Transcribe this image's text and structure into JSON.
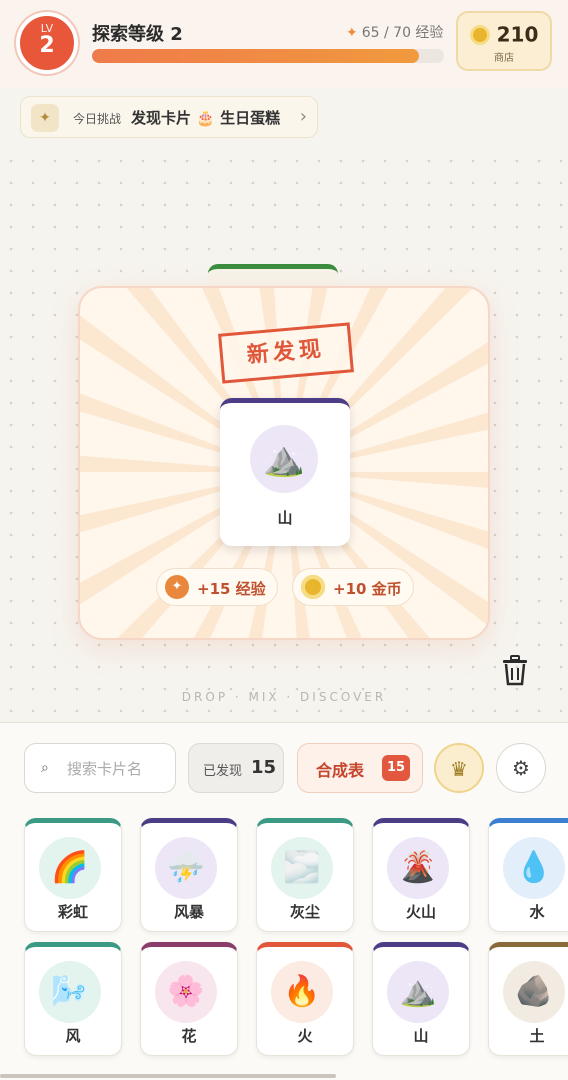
{
  "header": {
    "level_prefix": "LV",
    "level": "2",
    "level_title": "探索等级 2",
    "xp_text": "65 / 70 经验",
    "xp_fraction": 0.93,
    "coins": "210",
    "shop_label": "商店"
  },
  "challenge": {
    "label": "今日挑战",
    "text": "发现卡片 🎂 生日蛋糕"
  },
  "board": {
    "footer_text": "DROP · MIX · DISCOVER"
  },
  "popup": {
    "stamp": "新发现",
    "card": {
      "name": "山",
      "icon": "⛰️",
      "color": "#4d3d87",
      "bg": "#ede6f7"
    },
    "rewards": [
      {
        "text": "+15 经验",
        "icon": "xp-star-icon"
      },
      {
        "text": "+10 金币",
        "icon": "coin-icon"
      }
    ]
  },
  "toolbar": {
    "search_placeholder": "搜索卡片名",
    "discovered_label": "已发现",
    "discovered_count": "15",
    "recipe_label": "合成表",
    "recipe_count": "15"
  },
  "cards": [
    {
      "name": "彩虹",
      "icon": "🌈",
      "color": "#3a9a84",
      "bg": "#e3f3ee"
    },
    {
      "name": "风暴",
      "icon": "⛈️",
      "color": "#4d3d87",
      "bg": "#ede6f7"
    },
    {
      "name": "灰尘",
      "icon": "🌫️",
      "color": "#3a9a84",
      "bg": "#e3f3ee"
    },
    {
      "name": "火山",
      "icon": "🌋",
      "color": "#4d3d87",
      "bg": "#ede6f7"
    },
    {
      "name": "水",
      "icon": "💧",
      "color": "#3c7fd1",
      "bg": "#e3eefb"
    },
    {
      "name": "风",
      "icon": "🌬️",
      "color": "#3a9a84",
      "bg": "#e3f3ee"
    },
    {
      "name": "花",
      "icon": "🌸",
      "color": "#8a3c6a",
      "bg": "#f8e6ef"
    },
    {
      "name": "火",
      "icon": "🔥",
      "color": "#e0573a",
      "bg": "#fcebe3"
    },
    {
      "name": "山",
      "icon": "⛰️",
      "color": "#4d3d87",
      "bg": "#ede6f7"
    },
    {
      "name": "土",
      "icon": "🪨",
      "color": "#8a6a3a",
      "bg": "#f1ebe2"
    }
  ]
}
